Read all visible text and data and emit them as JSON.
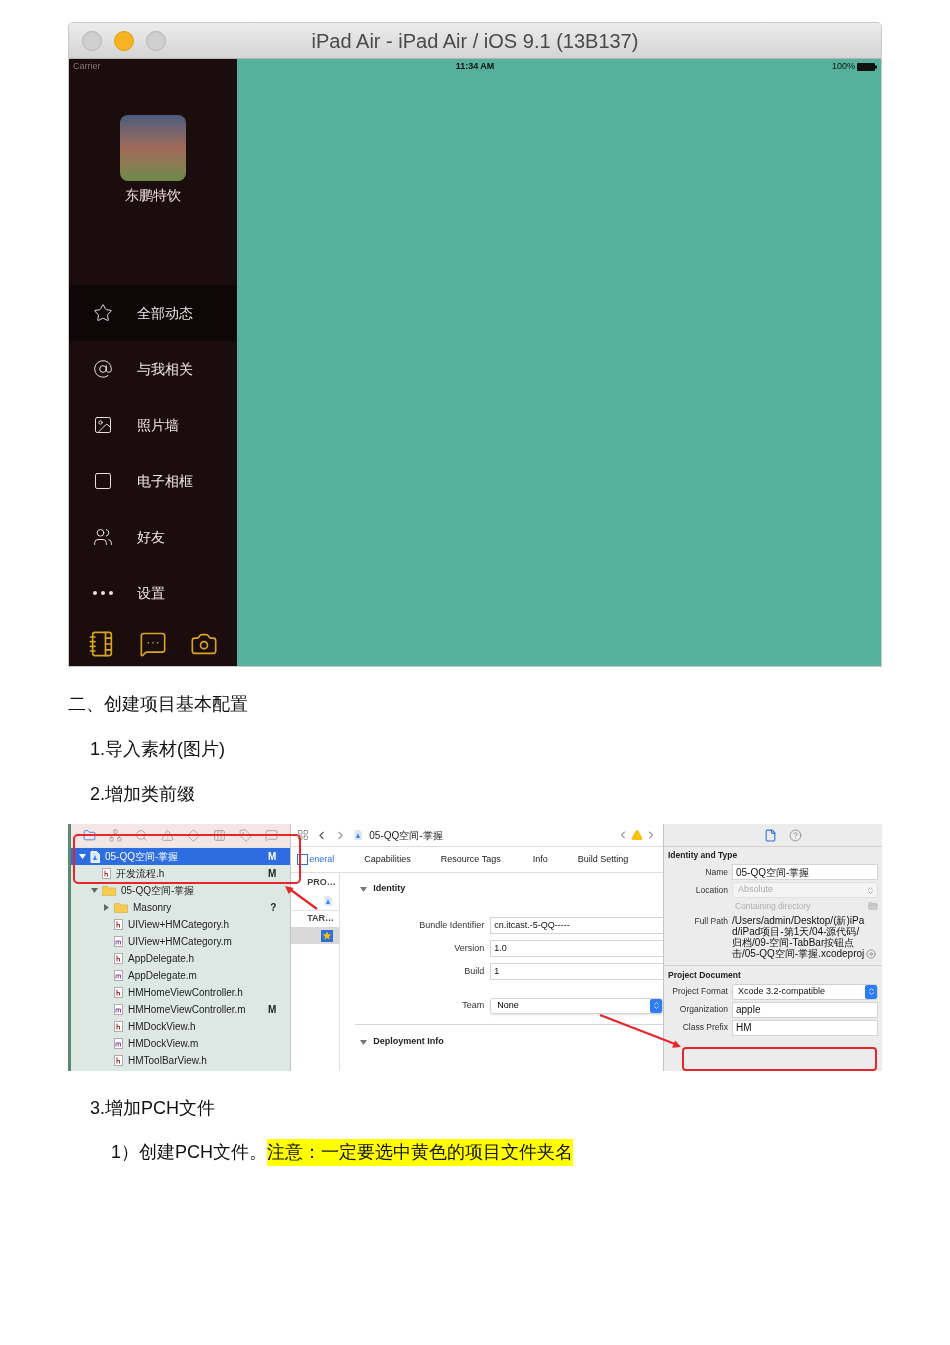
{
  "simulator": {
    "title": "iPad Air - iPad Air / iOS 9.1 (13B137)",
    "status_bar": {
      "carrier": "Carrier",
      "time": "11:34 AM",
      "battery": "100%"
    },
    "profile": {
      "name": "东鹏特饮"
    },
    "menu": [
      {
        "label": "全部动态",
        "selected": true
      },
      {
        "label": "与我相关",
        "selected": false
      },
      {
        "label": "照片墙",
        "selected": false
      },
      {
        "label": "电子相框",
        "selected": false
      },
      {
        "label": "好友",
        "selected": false
      },
      {
        "label": "设置",
        "selected": false
      }
    ]
  },
  "heading": "二、创建项目基本配置",
  "steps": [
    "1.导入素材(图片)",
    "2.增加类前缀"
  ],
  "xcode": {
    "navigator": {
      "tabs": [
        {
          "selected": true
        },
        {
          "selected": false
        },
        {
          "selected": false
        },
        {
          "selected": false
        },
        {
          "selected": false
        },
        {
          "selected": false
        },
        {
          "selected": false
        },
        {
          "selected": false
        }
      ],
      "tree": [
        {
          "name": "05-QQ空间-掌握",
          "kind": "project",
          "badge": "M",
          "selected": true,
          "expanded": true,
          "children": [
            {
              "name": "开发流程.h",
              "kind": "h",
              "badge": "M",
              "selected": false
            },
            {
              "name": "05-QQ空间-掌握",
              "kind": "folder",
              "selected": false,
              "expanded": true,
              "children": [
                {
                  "name": "Masonry",
                  "kind": "folder",
                  "badge": "?",
                  "selected": false,
                  "expanded": false
                },
                {
                  "name": "UIView+HMCategory.h",
                  "kind": "h",
                  "selected": false
                },
                {
                  "name": "UIView+HMCategory.m",
                  "kind": "m",
                  "selected": false
                },
                {
                  "name": "AppDelegate.h",
                  "kind": "h",
                  "selected": false
                },
                {
                  "name": "AppDelegate.m",
                  "kind": "m",
                  "selected": false
                },
                {
                  "name": "HMHomeViewController.h",
                  "kind": "h",
                  "selected": false
                },
                {
                  "name": "HMHomeViewController.m",
                  "kind": "m",
                  "badge": "M",
                  "selected": false
                },
                {
                  "name": "HMDockView.h",
                  "kind": "h",
                  "selected": false
                },
                {
                  "name": "HMDockView.m",
                  "kind": "m",
                  "selected": false
                },
                {
                  "name": "HMToolBarView.h",
                  "kind": "h",
                  "selected": false
                }
              ]
            }
          ]
        }
      ]
    },
    "editor": {
      "breadcrumb": "05-QQ空间-掌握",
      "tabs": [
        {
          "label": "eneral",
          "selected": true
        },
        {
          "label": "Capabilities",
          "selected": false
        },
        {
          "label": "Resource Tags",
          "selected": false
        },
        {
          "label": "Info",
          "selected": false
        },
        {
          "label": "Build Setting",
          "selected": false
        }
      ],
      "targets": [
        {
          "kind": "header",
          "label": "PRO…"
        },
        {
          "kind": "project",
          "selected": false
        },
        {
          "kind": "header",
          "label": "TAR…"
        },
        {
          "kind": "target",
          "selected": true
        }
      ],
      "sections": [
        {
          "title": "Identity",
          "expanded": true,
          "fields": [
            {
              "label": "Bundle Identifier",
              "value": "cn.itcast.-5-QQ-----",
              "kind": "text"
            },
            {
              "label": "Version",
              "value": "1.0",
              "kind": "text"
            },
            {
              "label": "Build",
              "value": "1",
              "kind": "text"
            },
            {
              "label": "Team",
              "value": "None",
              "kind": "select"
            }
          ]
        },
        {
          "title": "Deployment Info",
          "expanded": true
        }
      ]
    },
    "inspector": {
      "tabs": [
        {
          "selected": true
        },
        {
          "selected": false
        }
      ],
      "sections": [
        {
          "title": "Identity and Type",
          "rows": [
            {
              "label": "Name",
              "value": "05-QQ空间-掌握",
              "kind": "text"
            },
            {
              "label": "Location",
              "value": "Absolute",
              "kind": "select",
              "disabled": true
            },
            {
              "value": "Containing directory",
              "kind": "note"
            },
            {
              "label": "Full Path",
              "value": "/Users/admin/Desktop/(新)iPad/iPad项目-第1天/04-源代码/归档/09-空间-TabBar按钮点击/05-QQ空间-掌握.xcodeproj",
              "kind": "path"
            }
          ]
        },
        {
          "title": "Project Document",
          "rows": [
            {
              "label": "Project Format",
              "value": "Xcode 3.2-compatible",
              "kind": "select",
              "disabled": false
            },
            {
              "label": "Organization",
              "value": "apple",
              "kind": "text"
            },
            {
              "label": "Class Prefix",
              "value": "HM",
              "kind": "text"
            }
          ]
        }
      ]
    }
  },
  "steps_after": [
    "3.增加PCH文件"
  ],
  "substep": {
    "text": "1）创建PCH文件。",
    "highlight": "注意：一定要选中黄色的项目文件夹名"
  }
}
